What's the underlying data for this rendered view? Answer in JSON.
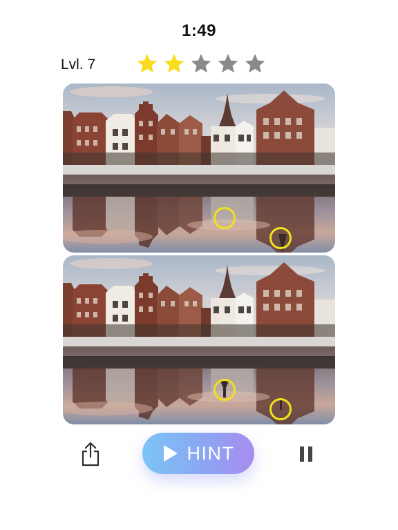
{
  "header": {
    "timer": "1:49",
    "level_label": "Lvl. 7"
  },
  "rating": {
    "max_stars": 5,
    "earned_stars": 2,
    "filled_color": "#f7dc1f",
    "empty_color": "#8a8a8a"
  },
  "panels": [
    {
      "label": "original-image",
      "found_markers": 2
    },
    {
      "label": "modified-image",
      "found_markers": 2
    }
  ],
  "marker_color": "#f2e21a",
  "toolbar": {
    "share_icon": "share-icon",
    "hint_icon": "play-icon",
    "hint_label": "HINT",
    "pause_icon": "pause-icon"
  }
}
